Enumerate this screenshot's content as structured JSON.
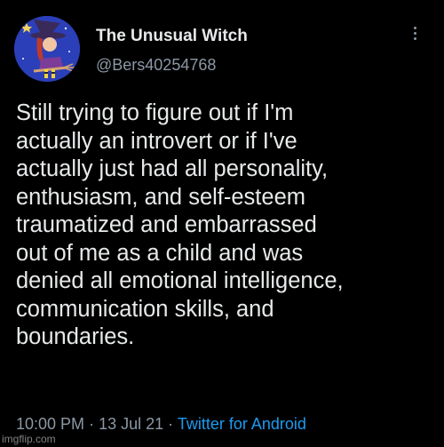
{
  "author": {
    "display_name": "The Unusual Witch",
    "handle": "@Bers40254768",
    "avatar_icon": "witch-avatar-icon"
  },
  "more_icon": "more-vertical-icon",
  "tweet": {
    "text": "Still trying to figure out if I'm\nactually an introvert or if I've\nactually just had all personality,\nenthusiasm, and self-esteem\ntraumatized and embarrassed\nout of me as a child and was\ndenied all emotional intelligence,\ncommunication skills, and\nboundaries.",
    "time": "10:00 PM",
    "date": "13 Jul 21",
    "separator": "·",
    "source": "Twitter for Android"
  },
  "watermark": "imgflip.com",
  "colors": {
    "background": "#000000",
    "primary_text": "#e7e9ea",
    "secondary_text": "#8b98a5",
    "link": "#1d9bf0"
  }
}
